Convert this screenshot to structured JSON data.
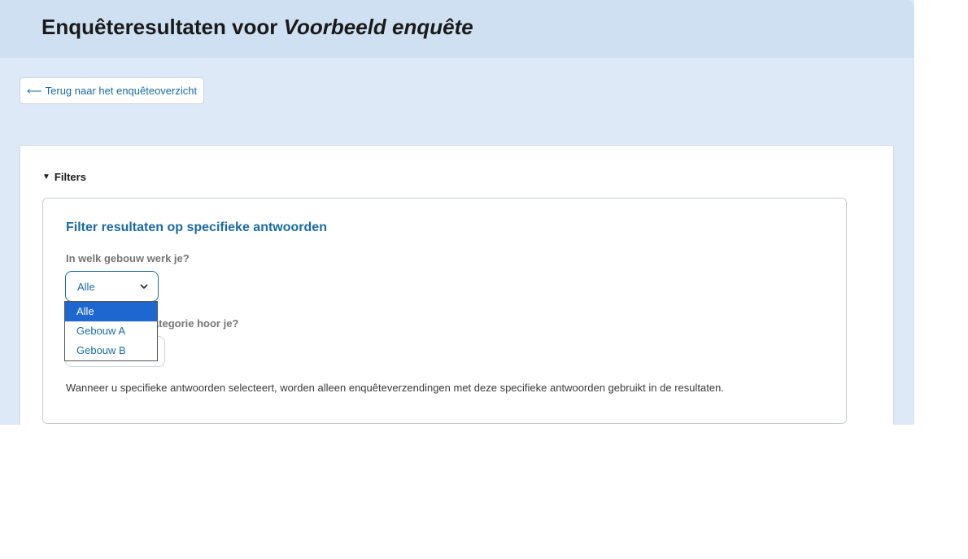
{
  "header": {
    "title_prefix": "Enquêteresultaten voor",
    "title_survey": "Voorbeeld enquête"
  },
  "back_link": {
    "arrow": "⟵",
    "label": "Terug naar het enquêteoverzicht"
  },
  "filters": {
    "toggle_label": "Filters",
    "legend": "Filter resultaten op specifieke antwoorden",
    "question_1": {
      "label": "In welk gebouw werk je?",
      "selected_value": "Alle",
      "options": [
        "Alle",
        "Gebouw A",
        "Gebouw B"
      ]
    },
    "question_2": {
      "label_visible": "categorie hoor je?"
    },
    "note": "Wanneer u specifieke antwoorden selecteert, worden alleen enquêteverzendingen met deze specifieke antwoorden gebruikt in de resultaten."
  },
  "icons": {
    "back": "arrow-left-icon",
    "toggle": "triangle-down-icon",
    "select": "chevron-down-icon"
  },
  "colors": {
    "accent": "#1a6ba3",
    "header_bg": "#cfe0f2",
    "page_bg": "#dde9f7",
    "selected_option_bg": "#1e66d0"
  }
}
